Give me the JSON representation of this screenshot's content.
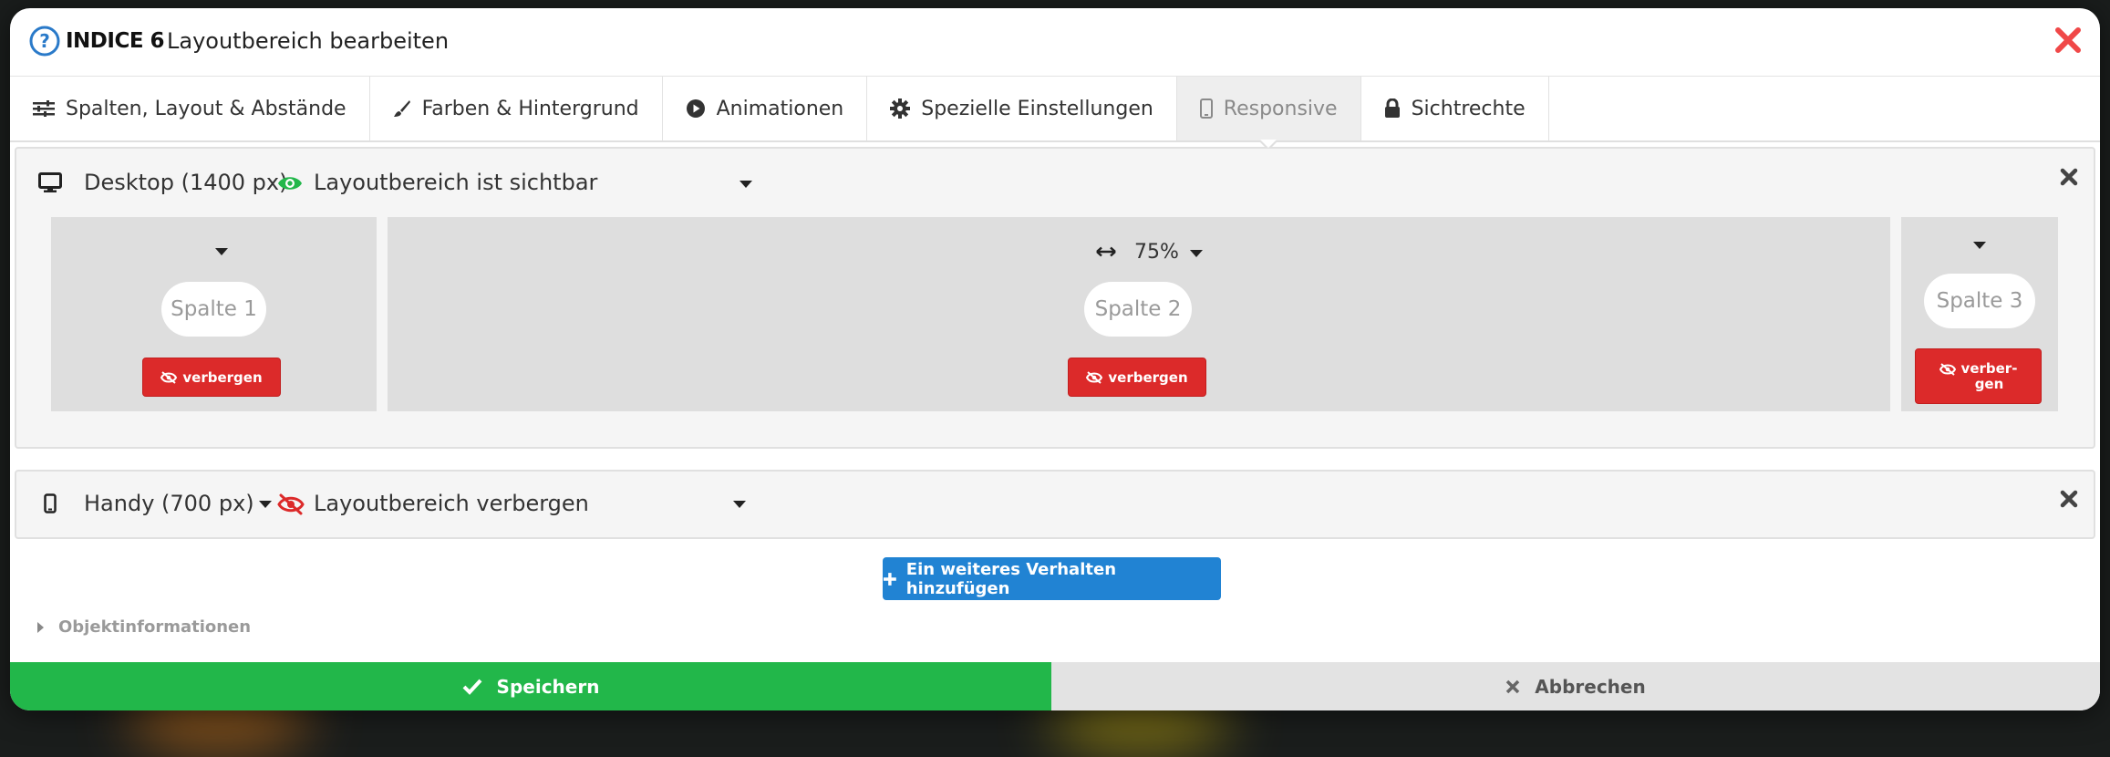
{
  "header": {
    "id_label": "INDICE 6",
    "title": "Layoutbereich bearbeiten"
  },
  "tabs": [
    {
      "label": "Spalten, Layout & Abstände",
      "icon": "sliders-icon"
    },
    {
      "label": "Farben & Hintergrund",
      "icon": "brush-icon"
    },
    {
      "label": "Animationen",
      "icon": "play-icon"
    },
    {
      "label": "Spezielle Einstellungen",
      "icon": "gear-icon"
    },
    {
      "label": "Responsive",
      "icon": "phone-icon",
      "active": true
    },
    {
      "label": "Sichtrechte",
      "icon": "lock-icon"
    }
  ],
  "behaviors": [
    {
      "device": "Desktop (1400 px)",
      "visibility": "Layoutbereich ist sichtbar",
      "columns": [
        {
          "name": "Spalte 1",
          "width": "",
          "hide_label": "verbergen"
        },
        {
          "name": "Spalte 2",
          "width": "75%",
          "hide_label": "verbergen"
        },
        {
          "name": "Spalte 3",
          "width": "",
          "hide_label": "verber-\ngen"
        }
      ]
    },
    {
      "device": "Handy (700 px)",
      "visibility": "Layoutbereich verbergen"
    }
  ],
  "add_behavior_label": "Ein weiteres Verhalten hinzufügen",
  "object_info_label": "Objektinformationen",
  "footer": {
    "save_label": "Speichern",
    "cancel_label": "Abbrechen"
  },
  "colors": {
    "save": "#22b74a",
    "add": "#2183d3",
    "hide": "#dc2a2a",
    "visible_eye": "#22b74a",
    "hidden_eye": "#dc2a2a",
    "close": "#f04848"
  }
}
